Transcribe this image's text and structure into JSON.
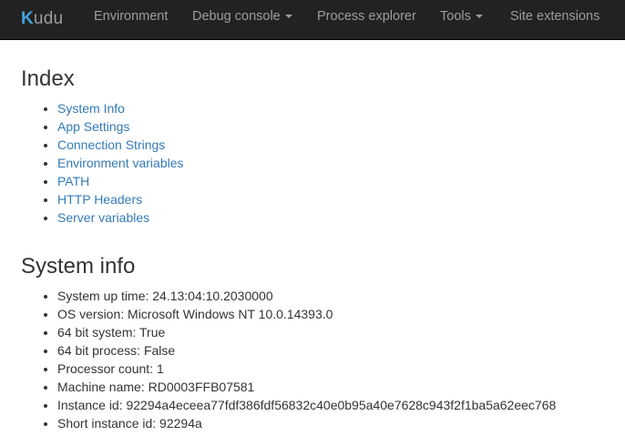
{
  "navbar": {
    "brand_first": "K",
    "brand_rest": "udu",
    "items": [
      {
        "label": "Environment"
      },
      {
        "label": "Debug console"
      },
      {
        "label": "Process explorer"
      },
      {
        "label": "Tools"
      },
      {
        "label": "Site extensions"
      }
    ]
  },
  "index": {
    "title": "Index",
    "links": [
      "System Info",
      "App Settings",
      "Connection Strings",
      "Environment variables",
      "PATH",
      "HTTP Headers",
      "Server variables"
    ]
  },
  "system_info": {
    "title": "System info",
    "items": [
      "System up time: 24.13:04:10.2030000",
      "OS version: Microsoft Windows NT 10.0.14393.0",
      "64 bit system: True",
      "64 bit process: False",
      "Processor count: 1",
      "Machine name: RD0003FFB07581",
      "Instance id: 92294a4eceea77fdf386fdf56832c40e0b95a40e7628c943f2f1ba5a62eec768",
      "Short instance id: 92294a"
    ]
  }
}
